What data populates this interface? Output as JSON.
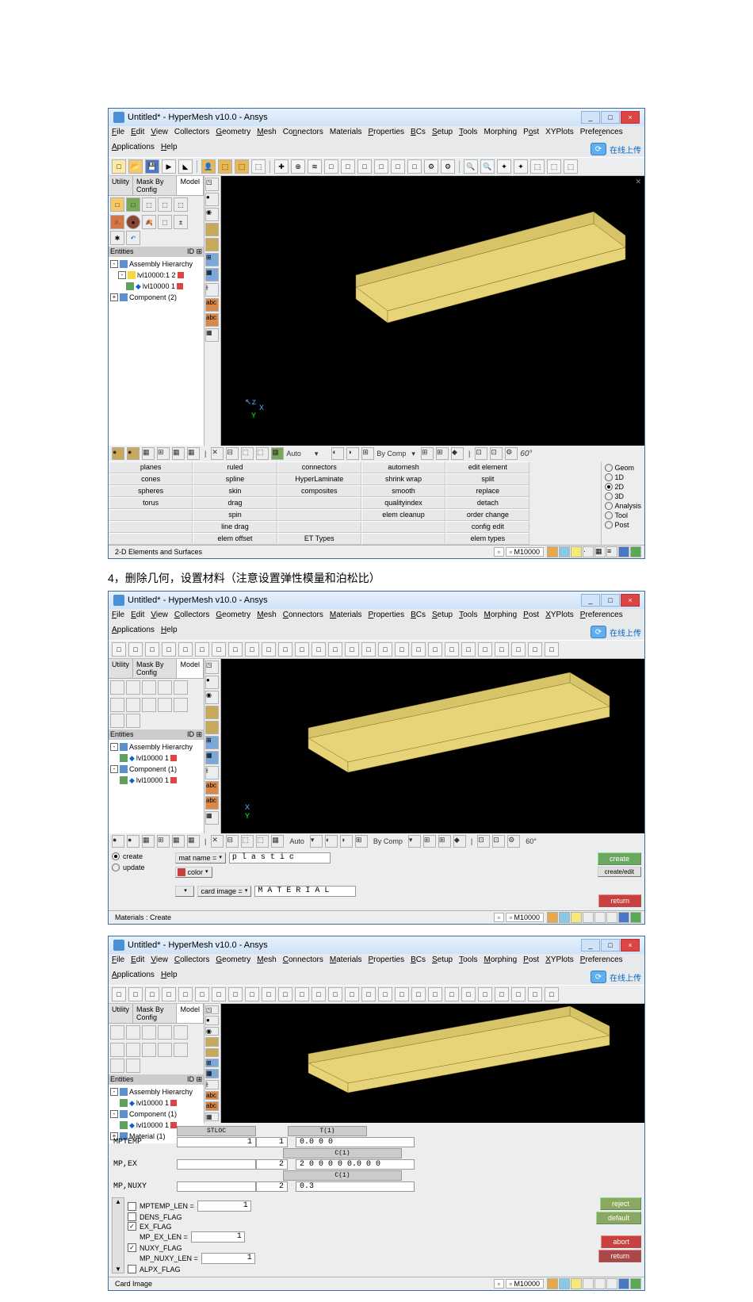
{
  "win1": {
    "title": "Untitled* - HyperMesh v10.0 - Ansys",
    "menus": [
      "File",
      "Edit",
      "View",
      "Collectors",
      "Geometry",
      "Mesh",
      "Connectors",
      "Materials",
      "Properties",
      "BCs",
      "Setup",
      "Tools",
      "Morphing",
      "Post",
      "XYPlots",
      "Preferences",
      "Applications",
      "Help"
    ],
    "topbtn": "在线上传",
    "ltabs": [
      "Utility",
      "Mask By Config",
      "Model"
    ],
    "entities": "Entities",
    "idcfg": "ID",
    "tree": [
      "Assembly Hierarchy",
      "lvl10000:1   2",
      "lvl10000   1",
      "Component (2)"
    ],
    "axes": {
      "x": "X",
      "y": "Y"
    },
    "vtb": {
      "auto": "Auto",
      "bycomp": "By Comp"
    },
    "grid": {
      "cols": [
        [
          "planes",
          "cones",
          "spheres",
          "torus",
          "",
          "",
          ""
        ],
        [
          "ruled",
          "spline",
          "skin",
          "drag",
          "spin",
          "line drag",
          "elem offset"
        ],
        [
          "connectors",
          "HyperLaminate",
          "composites",
          "",
          "",
          "",
          "ET Types"
        ],
        [
          "automesh",
          "shrink wrap",
          "smooth",
          "qualityindex",
          "elem cleanup",
          "",
          ""
        ],
        [
          "edit element",
          "split",
          "replace",
          "detach",
          "order change",
          "config edit",
          "elem types"
        ]
      ],
      "radios": [
        "Geom",
        "1D",
        "2D",
        "3D",
        "Analysis",
        "Tool",
        "Post"
      ],
      "sel": 2
    },
    "status": "2-D Elements and Surfaces",
    "sbox": "M10000"
  },
  "caption": "4，删除几何，设置材料（注意设置弹性模量和泊松比）",
  "win2": {
    "title": "Untitled* - HyperMesh v10.0 - Ansys",
    "menus": [
      "File",
      "Edit",
      "View",
      "Collectors",
      "Geometry",
      "Mesh",
      "Connectors",
      "Materials",
      "Properties",
      "BCs",
      "Setup",
      "Tools",
      "Morphing",
      "Post",
      "XYPlots",
      "Preferences",
      "Applications",
      "Help"
    ],
    "topbtn": "在线上传",
    "tree": [
      "Assembly Hierarchy",
      "lvl10000   1",
      "Component (1)",
      "lvl10000   1"
    ],
    "mat": {
      "modes": [
        "create",
        "update"
      ],
      "matname_lbl": "mat name =",
      "matname": "p l a s t i c",
      "color": "color",
      "cardimage_lbl": "card image =",
      "cardimage": "M A T E R I A L",
      "create": "create",
      "edit": "create/edit",
      "return": "return"
    },
    "status": "Materials : Create",
    "sbox": "M10000"
  },
  "win3": {
    "title": "Untitled* - HyperMesh v10.0 - Ansys",
    "menus": [
      "File",
      "Edit",
      "View",
      "Collectors",
      "Geometry",
      "Mesh",
      "Connectors",
      "Materials",
      "Properties",
      "BCs",
      "Setup",
      "Tools",
      "Morphing",
      "Post",
      "XYPlots",
      "Preferences",
      "Applications",
      "Help"
    ],
    "topbtn": "在线上传",
    "tree": [
      "Assembly Hierarchy",
      "lvl10000   1",
      "Component (1)",
      "lvl10000   1",
      "Material (1)"
    ],
    "card": {
      "hdr1": "STLOC",
      "hdr2": "T(1)",
      "rows": [
        {
          "lbl": "MPTEMP",
          "c1": "1",
          "c2": "1",
          "v1": "0.0 0 0",
          "sub": "C(1)"
        },
        {
          "lbl": "MP,EX",
          "c1": "",
          "c2": "2",
          "v1": "2 0 0 0 0 0.0 0 0",
          "sub": "C(1)"
        },
        {
          "lbl": "MP,NUXY",
          "c1": "",
          "c2": "2",
          "v1": "0.3",
          "sub": ""
        }
      ],
      "flags": [
        {
          "lbl": "MPTEMP_LEN =",
          "on": false,
          "val": "1"
        },
        {
          "lbl": "DENS_FLAG",
          "on": false
        },
        {
          "lbl": "EX_FLAG",
          "on": true
        },
        {
          "lbl": "MP_EX_LEN =",
          "val": "1"
        },
        {
          "lbl": "NUXY_FLAG",
          "on": true
        },
        {
          "lbl": "MP_NUXY_LEN =",
          "val": "1"
        },
        {
          "lbl": "ALPX_FLAG",
          "on": false
        }
      ],
      "reject": "reject",
      "default": "default",
      "abort": "abort",
      "return": "return"
    },
    "status": "Card Image",
    "sbox": "M10000"
  }
}
